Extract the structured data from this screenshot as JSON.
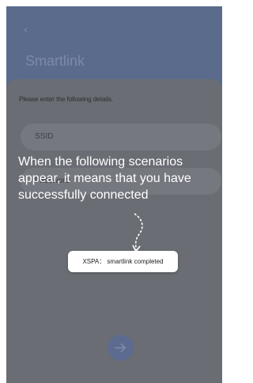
{
  "header": {
    "back_icon": "chevron-left-icon",
    "title": "Smartlink"
  },
  "form": {
    "instruction": "Please enter the following details.",
    "ssid_placeholder": "SSID",
    "password_placeholder": "Password"
  },
  "overlay": {
    "message": "When the following scenarios appear, it means that you have successfully connected",
    "arrow_icon": "curved-arrow-down-icon"
  },
  "toast": {
    "text": "XSPA： smartlink completed"
  },
  "actions": {
    "next_icon": "arrow-right-icon"
  },
  "colors": {
    "header_bg": "#5a6b8c",
    "sheet_bg": "#6a6d74",
    "toast_bg": "#ffffff",
    "accent": "#5e6b90"
  }
}
